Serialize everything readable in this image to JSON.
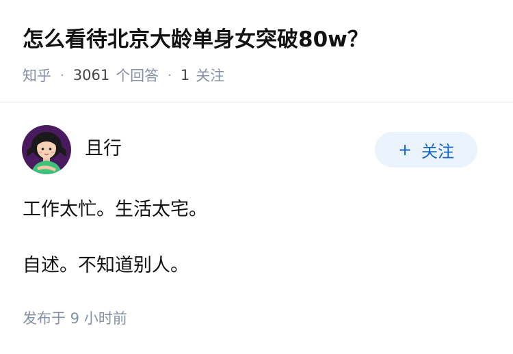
{
  "question": {
    "title": "怎么看待北京大龄单身女突破80w？",
    "source": "知乎",
    "separator": "·",
    "answer_count": "3061",
    "answer_count_label": "个回答",
    "follower_count": "1",
    "follower_label": "关注"
  },
  "answer": {
    "author_name": "且行",
    "avatar_icon": "cartoon-avatar-icon",
    "follow_button": {
      "icon": "plus-icon",
      "icon_glyph": "+",
      "label": "关注"
    },
    "content_lines": [
      "工作太忙。生活太宅。",
      "自述。不知道别人。"
    ],
    "published_time": "发布于 9 小时前"
  },
  "colors": {
    "title": "#121212",
    "meta": "#8590a6",
    "follow_bg": "#ebf3fc",
    "follow_text": "#1766cb",
    "avatar_bg": "#4a1a5e",
    "avatar_shirt": "#3cc27a"
  }
}
